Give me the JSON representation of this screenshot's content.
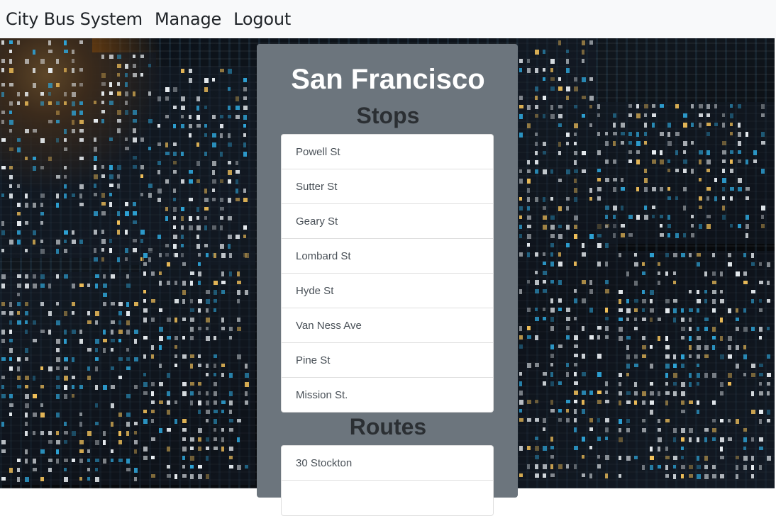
{
  "navbar": {
    "brand": "City Bus System",
    "manage": "Manage",
    "logout": "Logout"
  },
  "city": {
    "name": "San Francisco",
    "stops_heading": "Stops",
    "stops": [
      "Powell St",
      "Sutter St",
      "Geary St",
      "Lombard St",
      "Hyde St",
      "Van Ness Ave",
      "Pine St",
      "Mission St."
    ],
    "routes_heading": "Routes",
    "routes": [
      "30 Stockton",
      ""
    ]
  }
}
